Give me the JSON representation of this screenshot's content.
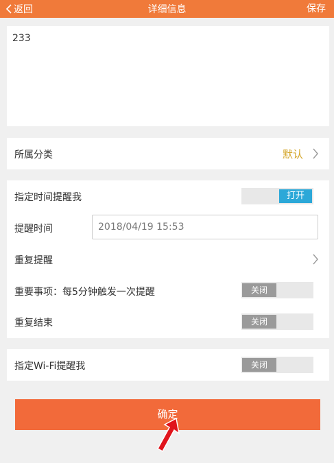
{
  "header": {
    "back_label": "返回",
    "title": "详细信息",
    "save_label": "保存"
  },
  "note": {
    "text": "233"
  },
  "category": {
    "label": "所属分类",
    "value": "默认"
  },
  "settings": {
    "timed_reminder": {
      "label": "指定时间提醒我",
      "toggle_text": "打开",
      "on": true
    },
    "reminder_time": {
      "label": "提醒时间",
      "value": "2018/04/19 15:53"
    },
    "repeat": {
      "label": "重复提醒"
    },
    "important": {
      "label": "重要事项：每5分钟触发一次提醒",
      "toggle_text": "关闭",
      "on": false
    },
    "repeat_end": {
      "label": "重复结束",
      "toggle_text": "关闭",
      "on": false
    }
  },
  "wifi": {
    "label": "指定Wi-Fi提醒我",
    "toggle_text": "关闭",
    "on": false
  },
  "confirm_label": "确定",
  "colors": {
    "header_bg": "#f07a3a",
    "accent_blue": "#2ca8d8",
    "category_value": "#d4a72c",
    "confirm_bg": "#f26a3a",
    "pointer_arrow": "#e0141c"
  }
}
